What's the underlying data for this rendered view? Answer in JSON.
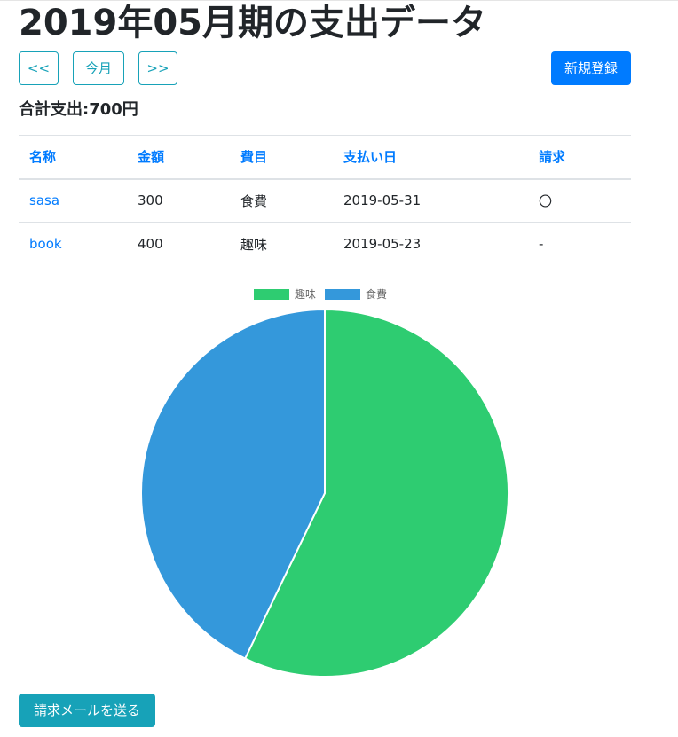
{
  "page": {
    "title": "2019年05月期の支出データ",
    "nav": {
      "prev": "<<",
      "current": "今月",
      "next": ">>"
    },
    "new_button": "新規登録",
    "total": "合計支出:700円",
    "send_mail_button": "請求メールを送る"
  },
  "table": {
    "headers": [
      "名称",
      "金額",
      "費目",
      "支払い日",
      "請求"
    ],
    "rows": [
      {
        "name": "sasa",
        "amount": "300",
        "category": "食費",
        "date": "2019-05-31",
        "billing": "〇"
      },
      {
        "name": "book",
        "amount": "400",
        "category": "趣味",
        "date": "2019-05-23",
        "billing": "-"
      }
    ]
  },
  "chart_data": {
    "type": "pie",
    "categories": [
      "趣味",
      "食費"
    ],
    "values": [
      400,
      300
    ],
    "colors": [
      "#2ecc71",
      "#3498db"
    ],
    "legend": "top"
  }
}
